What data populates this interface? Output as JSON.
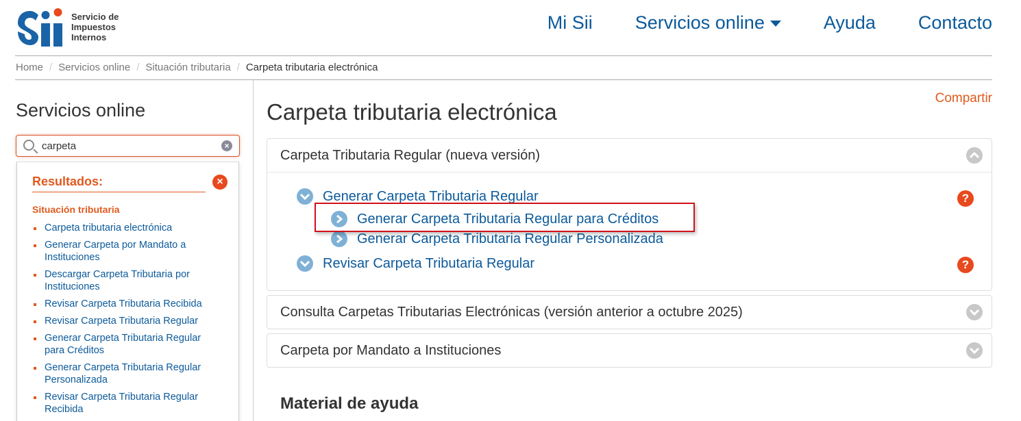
{
  "logo": {
    "mark_text": "Sii",
    "name_line1": "Servicio de",
    "name_line2": "Impuestos",
    "name_line3": "Internos"
  },
  "nav": {
    "mi_sii": "Mi Sii",
    "servicios_online": "Servicios online",
    "ayuda": "Ayuda",
    "contacto": "Contacto"
  },
  "breadcrumb": [
    "Home",
    "Servicios online",
    "Situación tributaria",
    "Carpeta tributaria electrónica"
  ],
  "sidebar": {
    "title": "Servicios online",
    "search_value": "carpeta",
    "results_title": "Resultados:",
    "category": "Situación tributaria",
    "results": [
      "Carpeta tributaria electrónica",
      "Generar Carpeta por Mandato a Instituciones",
      "Descargar Carpeta Tributaria por Instituciones",
      "Revisar Carpeta Tributaria Recibida",
      "Revisar Carpeta Tributaria Regular",
      "Generar Carpeta Tributaria Regular para Créditos",
      "Generar Carpeta Tributaria Regular Personalizada",
      "Revisar Carpeta Tributaria Regular Recibida"
    ]
  },
  "main": {
    "share": "Compartir",
    "title": "Carpeta tributaria electrónica",
    "panel1": {
      "heading": "Carpeta Tributaria Regular (nueva versión)",
      "generar": "Generar Carpeta Tributaria Regular",
      "generar_creditos": "Generar Carpeta Tributaria Regular para Créditos",
      "generar_personalizada": "Generar Carpeta Tributaria Regular Personalizada",
      "revisar": "Revisar Carpeta Tributaria Regular"
    },
    "panel2": {
      "heading": "Consulta Carpetas Tributarias Electrónicas (versión anterior a octubre 2025)"
    },
    "panel3": {
      "heading": "Carpeta por Mandato a Instituciones"
    },
    "material": "Material de ayuda"
  },
  "colors": {
    "brand_blue": "#0c5a9a",
    "accent_orange": "#e05a1f",
    "highlight_red": "#d0121b"
  }
}
